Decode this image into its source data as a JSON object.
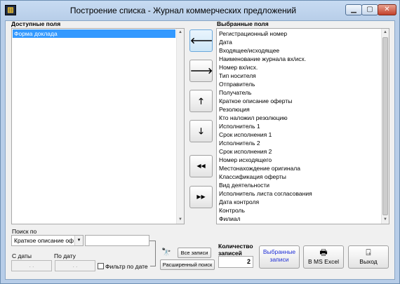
{
  "window": {
    "title": "Построение списка - Журнал коммерческих предложений",
    "app_icon": "book-icon",
    "controls": {
      "minimize": "▭",
      "maximize": "▭",
      "close": "✕"
    }
  },
  "available": {
    "label": "Доступные поля",
    "items": [
      "Форма доклада"
    ],
    "selected_index": 0
  },
  "selected": {
    "label": "Выбранные поля",
    "items": [
      "Регистрационный номер",
      "Дата",
      "Входящее/исходящее",
      "Наименование журнала вх/исх.",
      "Номер вх/исх.",
      "Тип носителя",
      "Отправитель",
      "Получатель",
      "Краткое описание оферты",
      "Резолюция",
      "Кто наложил резолюцию",
      "Исполнитель 1",
      "Срок исполнения 1",
      "Исполнитель 2",
      "Срок исполнения 2",
      "Номер исходящего",
      "Местонахождение оригинала",
      "Классификация оферты",
      "Вид деятельности",
      "Исполнитель листа согласования",
      "Дата контроля",
      "Контроль",
      "Филиал"
    ]
  },
  "move_buttons": {
    "add": "🡐",
    "remove": "🡒",
    "up": "🡑",
    "down": "🡓",
    "add_all": "◀◀",
    "remove_all": "▶▶"
  },
  "search": {
    "label": "Поиск по",
    "field_value": "Краткое описание оф",
    "combo_arrow": "▾",
    "text_value": "",
    "date_from_label": "С даты",
    "date_to_label": "По дату",
    "date_from_value": ". .",
    "date_to_value": ". .",
    "filter_by_date_label": "Фильтр по дате",
    "filter_by_date_checked": false,
    "binoculars_icon": "binoculars-icon",
    "all_records_label": "Все записи",
    "advanced_search_label": "Расширенный поиск"
  },
  "count": {
    "label": "Количество записей",
    "value": "2"
  },
  "actions": {
    "selected_records_label": "Выбранные записи",
    "excel_label": "В MS Excel",
    "excel_icon": "printer-icon",
    "exit_label": "Выход",
    "exit_icon": "exit-door-icon"
  }
}
